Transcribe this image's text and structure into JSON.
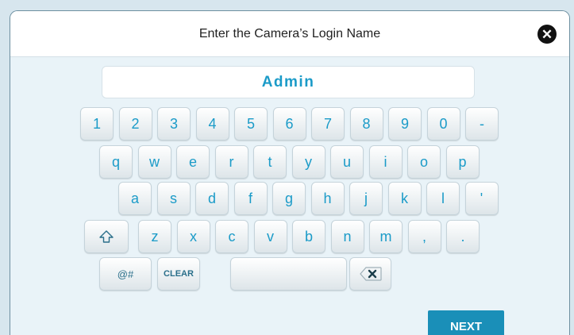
{
  "dialog": {
    "title": "Enter the Camera’s Login Name",
    "close_glyph": "✕",
    "entry_value": "Admin"
  },
  "keyboard": {
    "row1": [
      "1",
      "2",
      "3",
      "4",
      "5",
      "6",
      "7",
      "8",
      "9",
      "0",
      "-"
    ],
    "row2": [
      "q",
      "w",
      "e",
      "r",
      "t",
      "y",
      "u",
      "i",
      "o",
      "p"
    ],
    "row3": [
      "a",
      "s",
      "d",
      "f",
      "g",
      "h",
      "j",
      "k",
      "l",
      "'"
    ],
    "row4": [
      "z",
      "x",
      "c",
      "v",
      "b",
      "n",
      "m",
      ",",
      "."
    ],
    "symbols_label": "@#",
    "clear_label": "CLEAR",
    "shift_icon": "shift-icon",
    "backspace_icon": "backspace-icon"
  },
  "footer": {
    "next_label": "NEXT"
  },
  "colors": {
    "accent": "#1b9bc8",
    "next_button": "#1a8fb8",
    "background": "#e9f3f8"
  }
}
